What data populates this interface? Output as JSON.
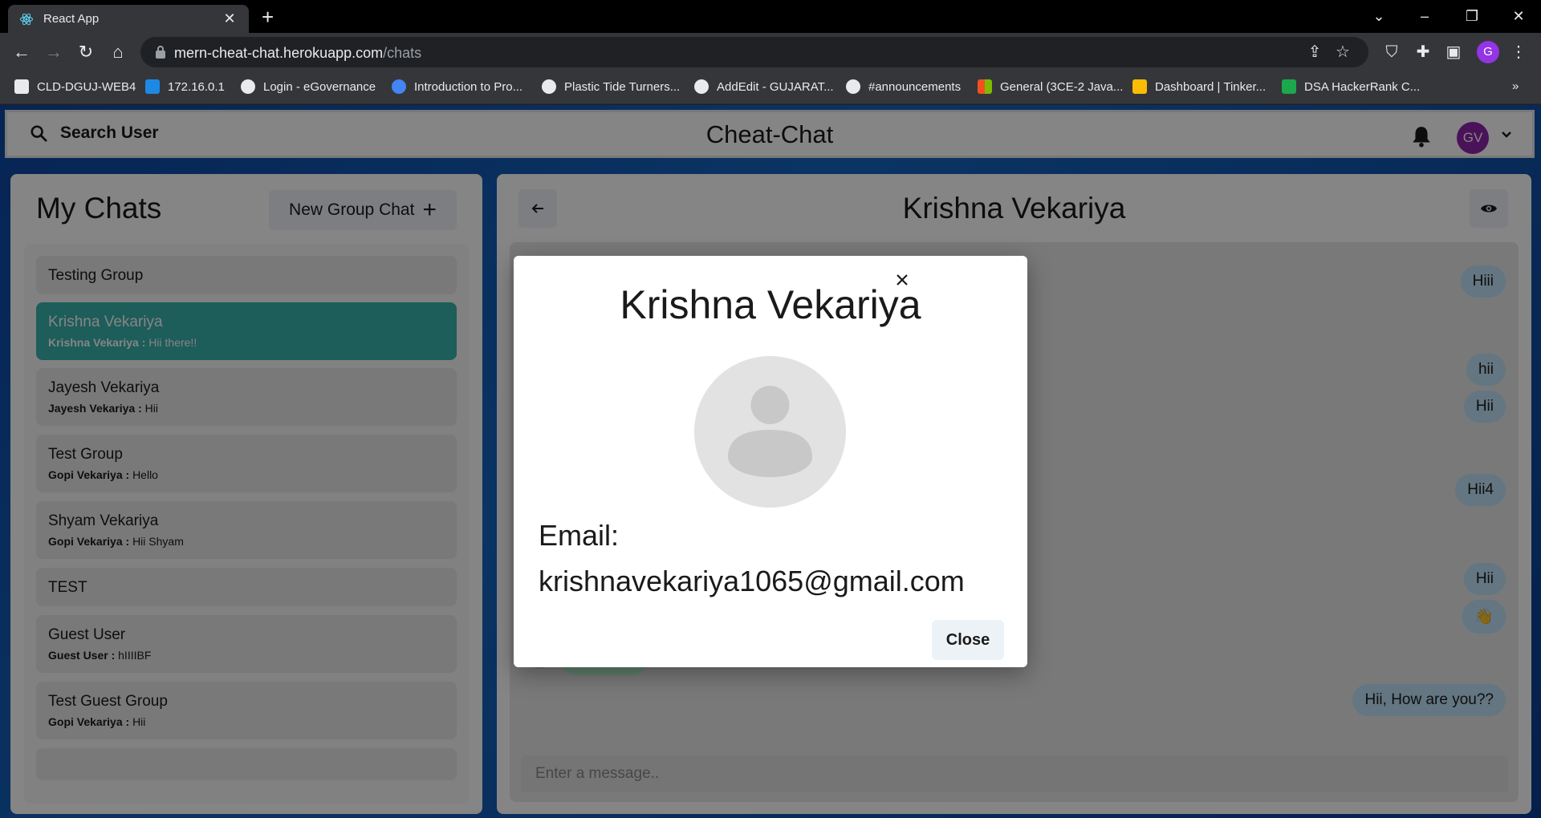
{
  "browser": {
    "tab_title": "React App",
    "url_host": "mern-cheat-chat.herokuapp.com",
    "url_path": "/chats",
    "profile_initial": "G",
    "bookmarks": [
      {
        "label": "CLD-DGUJ-WEB4",
        "icon_color": "#e8eaed"
      },
      {
        "label": "172.16.0.1",
        "icon_color": "#1e88e5"
      },
      {
        "label": "Login - eGovernance",
        "icon_color": "#e8eaed"
      },
      {
        "label": "Introduction to Pro...",
        "icon_color": "#4285f4"
      },
      {
        "label": "Plastic Tide Turners...",
        "icon_color": "#e8eaed"
      },
      {
        "label": "AddEdit - GUJARAT...",
        "icon_color": "#e8eaed"
      },
      {
        "label": "#announcements",
        "icon_color": "#e8eaed"
      },
      {
        "label": "General (3CE-2 Java...",
        "icon_color": "#f25022"
      },
      {
        "label": "Dashboard | Tinker...",
        "icon_color": "#fbbc05"
      },
      {
        "label": "DSA HackerRank C...",
        "icon_color": "#1ba94c"
      }
    ],
    "more_bookmarks": "»"
  },
  "app": {
    "search_label": "Search User",
    "brand": "Cheat-Chat",
    "user_initials": "GV",
    "colors": {
      "active_chat": "#38b2ac",
      "sent_bubble": "#bee3f8",
      "received_bubble": "#b9f5d0",
      "avatar": "#8e24aa"
    }
  },
  "sidebar": {
    "title": "My Chats",
    "new_group_label": "New Group Chat",
    "chats": [
      {
        "name": "Testing Group",
        "sender": "",
        "preview": ""
      },
      {
        "name": "Krishna Vekariya",
        "sender": "Krishna Vekariya : ",
        "preview": "Hii there!!"
      },
      {
        "name": "Jayesh Vekariya",
        "sender": "Jayesh Vekariya : ",
        "preview": "Hii"
      },
      {
        "name": "Test Group",
        "sender": "Gopi Vekariya : ",
        "preview": "Hello"
      },
      {
        "name": "Shyam Vekariya",
        "sender": "Gopi Vekariya : ",
        "preview": "Hii Shyam"
      },
      {
        "name": "TEST",
        "sender": "",
        "preview": ""
      },
      {
        "name": "Guest User",
        "sender": "Guest User : ",
        "preview": "hIIIIBF"
      },
      {
        "name": "Test Guest Group",
        "sender": "Gopi Vekariya : ",
        "preview": "Hii"
      }
    ]
  },
  "chat": {
    "title": "Krishna Vekariya",
    "messages": [
      {
        "text": "Hiii",
        "dir": "sent"
      },
      {
        "text": "hii",
        "dir": "sent"
      },
      {
        "text": "Hii",
        "dir": "sent"
      },
      {
        "text": "Hii4",
        "dir": "sent"
      },
      {
        "text": "Hii",
        "dir": "sent"
      },
      {
        "text": "👋",
        "dir": "sent"
      },
      {
        "text": "Hii there!!",
        "dir": "received"
      },
      {
        "text": "Hii, How are you??",
        "dir": "sent"
      }
    ],
    "input_placeholder": "Enter a message.."
  },
  "modal": {
    "title": "Krishna Vekariya",
    "email_label": "Email:",
    "email": "krishnavekariya1065@gmail.com",
    "close_label": "Close"
  }
}
